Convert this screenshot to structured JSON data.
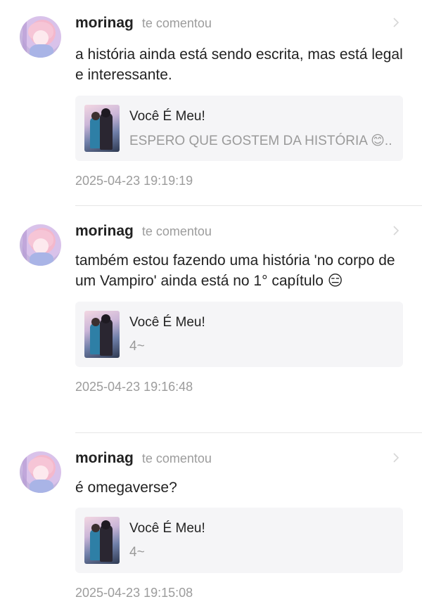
{
  "notifications": [
    {
      "username": "morinag",
      "action": "te comentou",
      "comment": "a história ainda está sendo escrita, mas está legal e interessante.",
      "story_title": "Você É Meu!",
      "story_excerpt": "ESPERO QUE GOSTEM DA HISTÓRIA 😊...",
      "timestamp": "2025-04-23 19:19:19"
    },
    {
      "username": "morinag",
      "action": "te comentou",
      "comment": "também estou fazendo uma história 'no corpo de um Vampiro' ainda está no 1° capítulo 😑",
      "story_title": "Você É Meu!",
      "story_excerpt": "4~",
      "timestamp": "2025-04-23 19:16:48"
    },
    {
      "username": "morinag",
      "action": "te comentou",
      "comment": "é omegaverse?",
      "story_title": "Você É Meu!",
      "story_excerpt": "4~",
      "timestamp": "2025-04-23 19:15:08"
    }
  ]
}
